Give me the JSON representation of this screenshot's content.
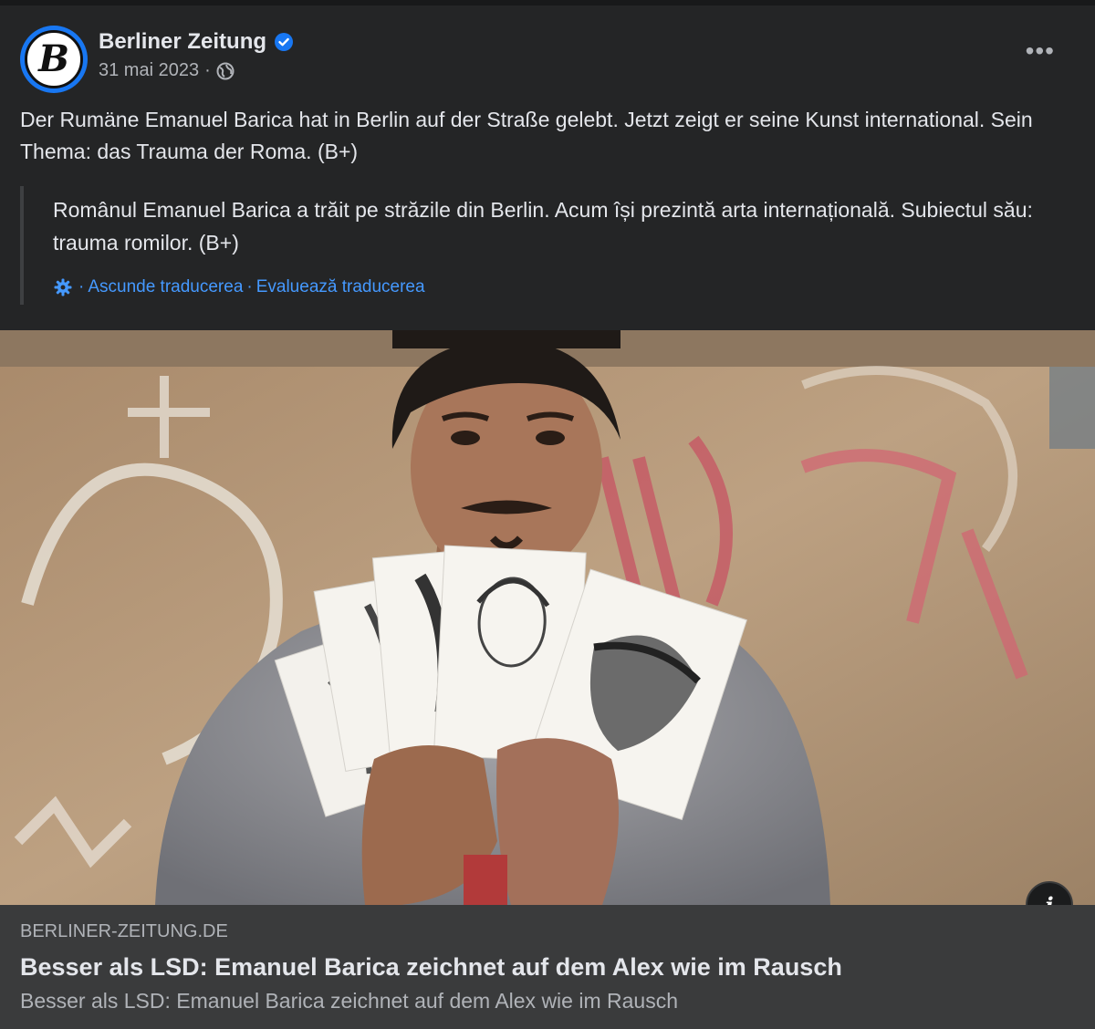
{
  "post": {
    "page_name": "Berliner Zeitung",
    "avatar_letter": "B",
    "date": "31 mai 2023",
    "separator": "·",
    "privacy_icon": "globe-icon",
    "more_label": "•••",
    "text": "Der Rumäne Emanuel Barica hat in Berlin auf der Straße gelebt. Jetzt zeigt er seine Kunst international. Sein Thema: das Trauma der Roma. (B+)"
  },
  "translation": {
    "text": "Românul Emanuel Barica a trăit pe străzile din Berlin. Acum își prezintă arta internațională. Subiectul său: trauma romilor. (B+)",
    "hide_label": "Ascunde traducerea",
    "rate_label": "Evaluează traducerea",
    "separator": "·"
  },
  "link_card": {
    "domain": "BERLINER-ZEITUNG.DE",
    "title": "Besser als LSD: Emanuel Barica zeichnet auf dem Alex wie im Rausch",
    "description": "Besser als LSD: Emanuel Barica zeichnet auf dem Alex wie im Rausch",
    "info_label": "i"
  },
  "colors": {
    "card_bg": "#242526",
    "link_blue": "#4599ff",
    "verified_blue": "#1877f2",
    "link_card_bg": "#3a3b3c"
  }
}
